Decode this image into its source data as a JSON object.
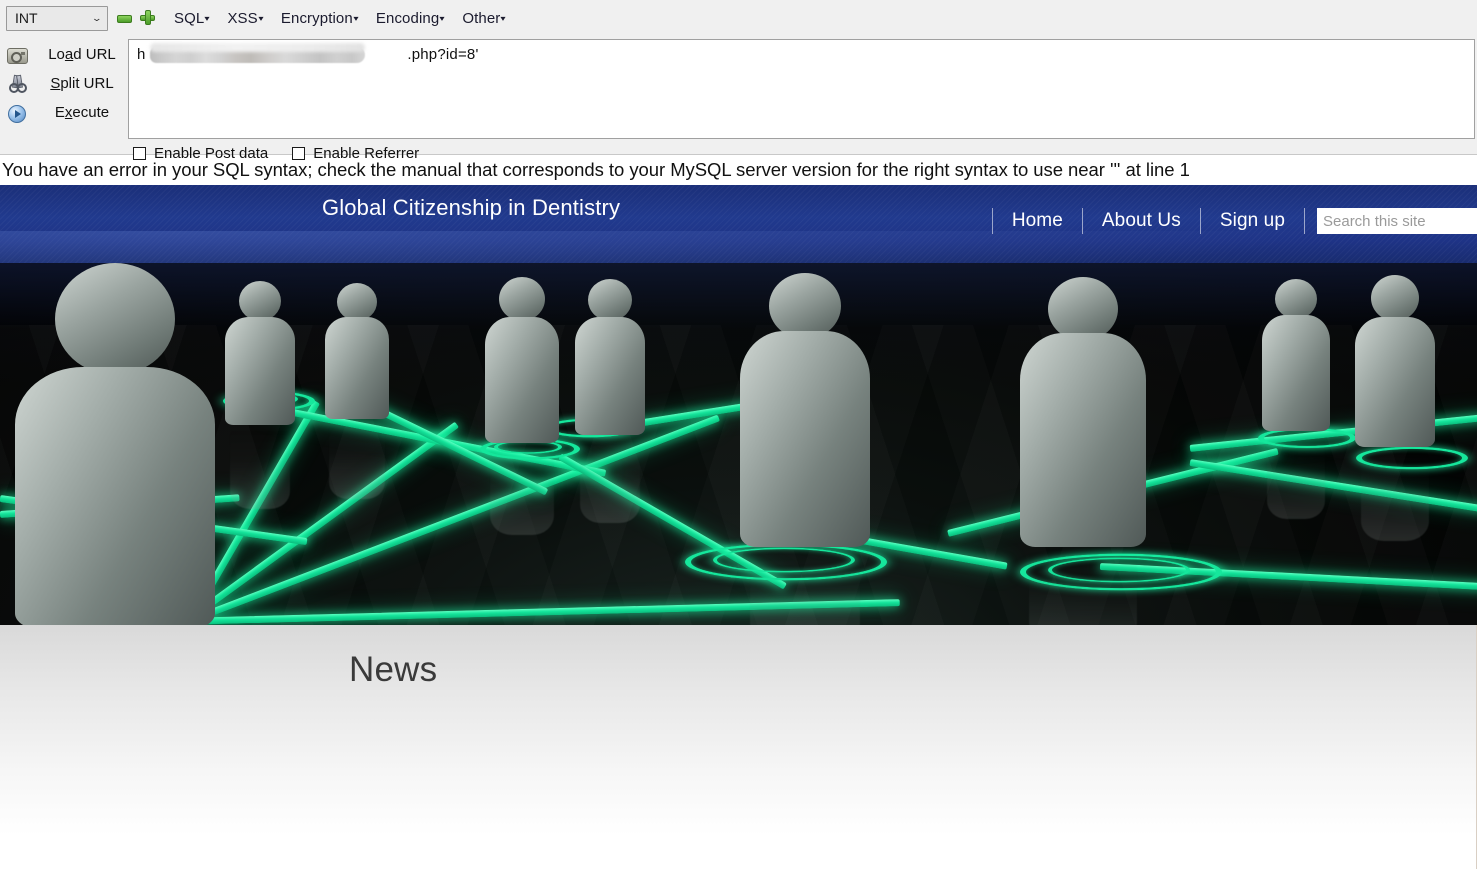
{
  "hackbar": {
    "type_select": {
      "value": "INT",
      "caret_icon": "chevron-down-icon"
    },
    "icons": {
      "remove": "minus-icon",
      "add": "plus-icon"
    },
    "menus": [
      {
        "label": "SQL",
        "arrow": "▾"
      },
      {
        "label": "XSS",
        "arrow": "▾"
      },
      {
        "label": "Encryption",
        "arrow": "▾"
      },
      {
        "label": "Encoding",
        "arrow": "▾"
      },
      {
        "label": "Other",
        "arrow": "▾"
      }
    ],
    "actions": [
      {
        "icon": "load-url-icon",
        "pre": "Lo",
        "accel": "a",
        "post": "d URL"
      },
      {
        "icon": "scissors-icon",
        "pre": "",
        "accel": "S",
        "post": "plit URL"
      },
      {
        "icon": "execute-play-icon",
        "pre": "E",
        "accel": "x",
        "post": "ecute"
      }
    ],
    "url": {
      "prefix": "h",
      "suffix": ".php?id=8'",
      "redacted": true
    },
    "checkboxes": [
      {
        "label": "Enable Post data",
        "checked": false
      },
      {
        "label": "Enable Referrer",
        "checked": false
      }
    ]
  },
  "sql_error": {
    "message": "You have an error in your SQL syntax; check the manual that corresponds to your MySQL server version for the right syntax to use near ''' at line 1"
  },
  "site": {
    "title": "Global Citizenship in Dentistry",
    "nav": [
      {
        "label": "Home"
      },
      {
        "label": "About Us"
      },
      {
        "label": "Sign up"
      }
    ],
    "search": {
      "placeholder": "Search this site",
      "value": ""
    },
    "banner": {
      "alt": "network of connected figures"
    },
    "content": {
      "heading": "News"
    }
  },
  "colors": {
    "header_blue": "#213a8e",
    "accent_green": "#16e79c",
    "toolbar_bg": "#f0f0f0",
    "error_text": "#111111"
  }
}
